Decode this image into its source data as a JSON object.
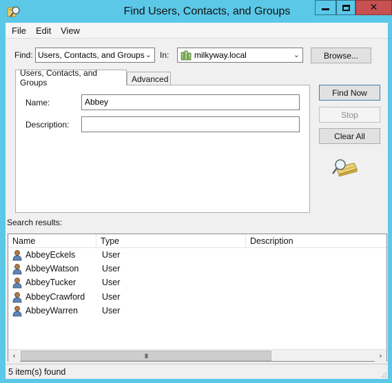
{
  "window": {
    "title": "Find Users, Contacts, and Groups",
    "icon": "find-users-icon",
    "controls": [
      "minimize",
      "maximize",
      "close"
    ]
  },
  "menubar": {
    "items": [
      "File",
      "Edit",
      "View"
    ]
  },
  "search": {
    "find_label": "Find:",
    "find_value": "Users, Contacts, and Groups",
    "in_label": "In:",
    "in_value": "milkyway.local",
    "in_icon": "domain-icon",
    "browse_label": "Browse..."
  },
  "tabs": [
    {
      "label": "Users, Contacts, and Groups",
      "active": true
    },
    {
      "label": "Advanced",
      "active": false
    }
  ],
  "form": {
    "name_label": "Name:",
    "name_value": "Abbey",
    "description_label": "Description:",
    "description_value": ""
  },
  "actions": {
    "find_now": "Find Now",
    "stop": "Stop",
    "clear_all": "Clear All"
  },
  "results": {
    "label": "Search results:",
    "columns": [
      "Name",
      "Type",
      "Description"
    ],
    "rows": [
      {
        "name": "AbbeyEckels",
        "type": "User",
        "description": ""
      },
      {
        "name": "AbbeyWatson",
        "type": "User",
        "description": ""
      },
      {
        "name": "AbbeyTucker",
        "type": "User",
        "description": ""
      },
      {
        "name": "AbbeyCrawford",
        "type": "User",
        "description": ""
      },
      {
        "name": "AbbeyWarren",
        "type": "User",
        "description": ""
      }
    ],
    "scroll_thumb_glyph": "III"
  },
  "status": {
    "text": "5 item(s) found"
  },
  "colors": {
    "titlebar": "#5bc8e8",
    "close_button": "#c75050",
    "client_bg": "#f0f0f0"
  }
}
